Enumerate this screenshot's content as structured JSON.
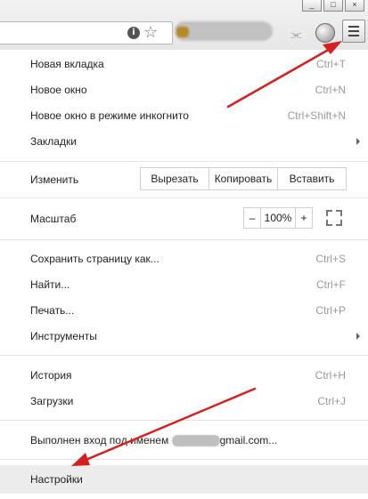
{
  "chrome": {
    "window_controls": [
      "_",
      "□",
      "×"
    ],
    "info_icon": "i",
    "icons": [
      "info-icon",
      "star-icon",
      "rss-icon",
      "extension-icon",
      "menu-icon"
    ]
  },
  "menu": {
    "new_tab": {
      "label": "Новая вкладка",
      "shortcut": "Ctrl+T"
    },
    "new_window": {
      "label": "Новое окно",
      "shortcut": "Ctrl+N"
    },
    "incognito": {
      "label": "Новое окно в режиме инкогнито",
      "shortcut": "Ctrl+Shift+N"
    },
    "bookmarks": {
      "label": "Закладки"
    },
    "edit": {
      "label": "Изменить",
      "cut": "Вырезать",
      "copy": "Копировать",
      "paste": "Вставить"
    },
    "zoom": {
      "label": "Масштаб",
      "minus": "–",
      "value": "100%",
      "plus": "+"
    },
    "save_page": {
      "label": "Сохранить страницу как...",
      "shortcut": "Ctrl+S"
    },
    "find": {
      "label": "Найти...",
      "shortcut": "Ctrl+F"
    },
    "print": {
      "label": "Печать...",
      "shortcut": "Ctrl+P"
    },
    "tools": {
      "label": "Инструменты"
    },
    "history": {
      "label": "История",
      "shortcut": "Ctrl+H"
    },
    "downloads": {
      "label": "Загрузки",
      "shortcut": "Ctrl+J"
    },
    "signed_in": {
      "prefix": "Выполнен вход под именем",
      "suffix": "gmail.com..."
    },
    "settings": {
      "label": "Настройки"
    }
  },
  "colors": {
    "annotation_arrow": "#d42020",
    "hover_background": "#ececec"
  }
}
